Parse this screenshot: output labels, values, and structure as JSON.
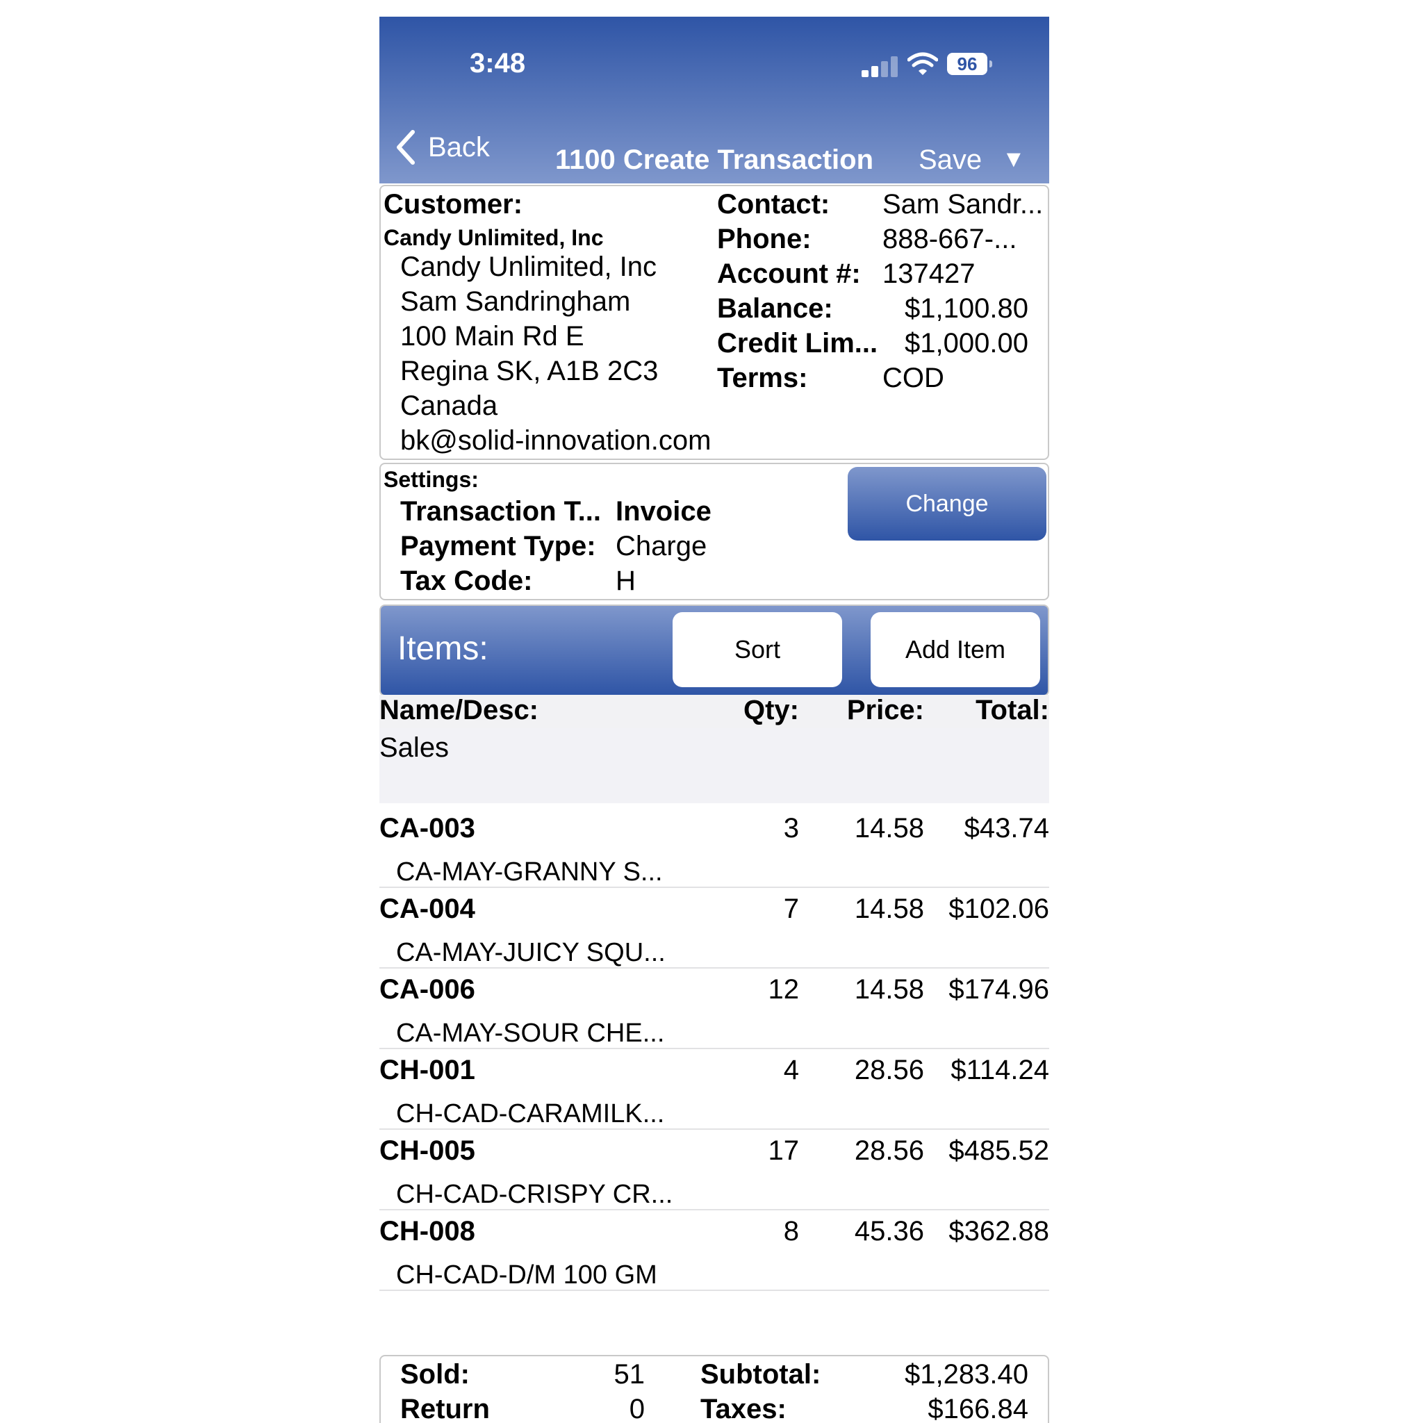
{
  "status_bar": {
    "time": "3:48",
    "battery": "96"
  },
  "nav": {
    "back_label": "Back",
    "title": "1100 Create Transaction",
    "save_label": "Save",
    "menu_glyph": "▼"
  },
  "customer": {
    "label": "Customer:",
    "name_bold": "Candy Unlimited, Inc",
    "address_lines": [
      "Candy Unlimited, Inc",
      "Sam Sandringham",
      "100 Main Rd E",
      "Regina SK, A1B 2C3",
      "Canada",
      "bk@solid-innovation.com"
    ],
    "fields": [
      {
        "label": "Contact:",
        "value": "Sam Sandr..."
      },
      {
        "label": "Phone:",
        "value": "888-667-..."
      },
      {
        "label": "Account #:",
        "value": "137427"
      },
      {
        "label": "Balance:",
        "value": "$1,100.80"
      },
      {
        "label": "Credit Lim...",
        "value": "$1,000.00"
      },
      {
        "label": "Terms:",
        "value": "COD"
      }
    ]
  },
  "settings": {
    "label": "Settings:",
    "change_label": "Change",
    "rows": [
      {
        "label": "Transaction T...",
        "value": "Invoice"
      },
      {
        "label": "Payment Type:",
        "value": "Charge"
      },
      {
        "label": "Tax Code:",
        "value": "H"
      }
    ]
  },
  "items": {
    "label": "Items:",
    "sort_label": "Sort",
    "add_label": "Add Item",
    "columns": {
      "name": "Name/Desc:",
      "qty": "Qty:",
      "price": "Price:",
      "total": "Total:"
    },
    "section": "Sales",
    "rows": [
      {
        "code": "CA-003",
        "qty": "3",
        "price": "14.58",
        "total": "$43.74",
        "desc": "CA-MAY-GRANNY S..."
      },
      {
        "code": "CA-004",
        "qty": "7",
        "price": "14.58",
        "total": "$102.06",
        "desc": "CA-MAY-JUICY SQU..."
      },
      {
        "code": "CA-006",
        "qty": "12",
        "price": "14.58",
        "total": "$174.96",
        "desc": "CA-MAY-SOUR CHE..."
      },
      {
        "code": "CH-001",
        "qty": "4",
        "price": "28.56",
        "total": "$114.24",
        "desc": "CH-CAD-CARAMILK..."
      },
      {
        "code": "CH-005",
        "qty": "17",
        "price": "28.56",
        "total": "$485.52",
        "desc": "CH-CAD-CRISPY CR..."
      },
      {
        "code": "CH-008",
        "qty": "8",
        "price": "45.36",
        "total": "$362.88",
        "desc": "CH-CAD-D/M 100 GM"
      }
    ]
  },
  "totals": {
    "sold_label": "Sold:",
    "sold_value": "51",
    "return_label": "Return",
    "return_value": "0",
    "subtotal_label": "Subtotal:",
    "subtotal_value": "$1,283.40",
    "taxes_label": "Taxes:",
    "taxes_value": "$166.84"
  }
}
